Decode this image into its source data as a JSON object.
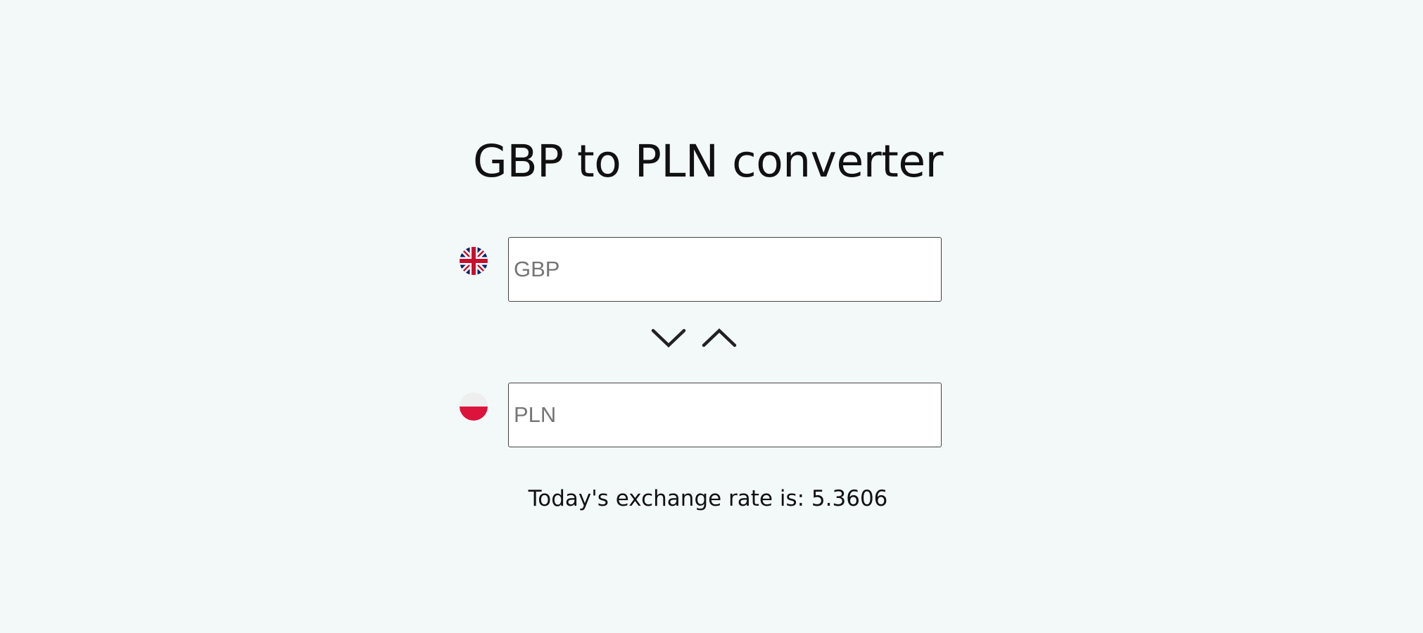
{
  "title": "GBP to PLN converter",
  "from_currency": {
    "flag_icon": "uk-flag-icon",
    "placeholder": "GBP",
    "value": ""
  },
  "to_currency": {
    "flag_icon": "poland-flag-icon",
    "placeholder": "PLN",
    "value": ""
  },
  "swap_controls": {
    "down_icon": "chevron-down-icon",
    "up_icon": "chevron-up-icon"
  },
  "rate": {
    "label": "Today's exchange rate is: 5.3606"
  },
  "colors": {
    "background": "#f3f9f9",
    "uk_blue": "#012169",
    "uk_red": "#C8102E",
    "pl_red": "#DC143C",
    "pl_white": "#EEEEEE"
  }
}
